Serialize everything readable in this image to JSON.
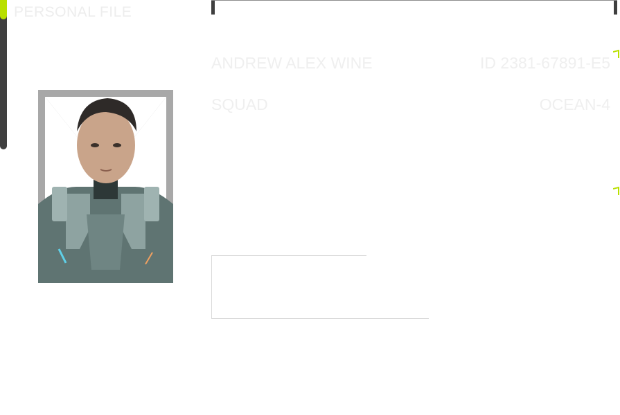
{
  "page": {
    "title": "PERSONAL FILE"
  },
  "profile": {
    "name": "ANDREW ALEX WINE",
    "id": "ID 2381-67891-E5",
    "squad_label": "SQUAD",
    "squad_value": "OCEAN-4",
    "photo_icon": "soldier-portrait"
  },
  "colors": {
    "accent": "#b9e000",
    "rail": "#3f3f3f",
    "faded_text": "#efefef",
    "frame_gray": "#a8a8a8"
  }
}
